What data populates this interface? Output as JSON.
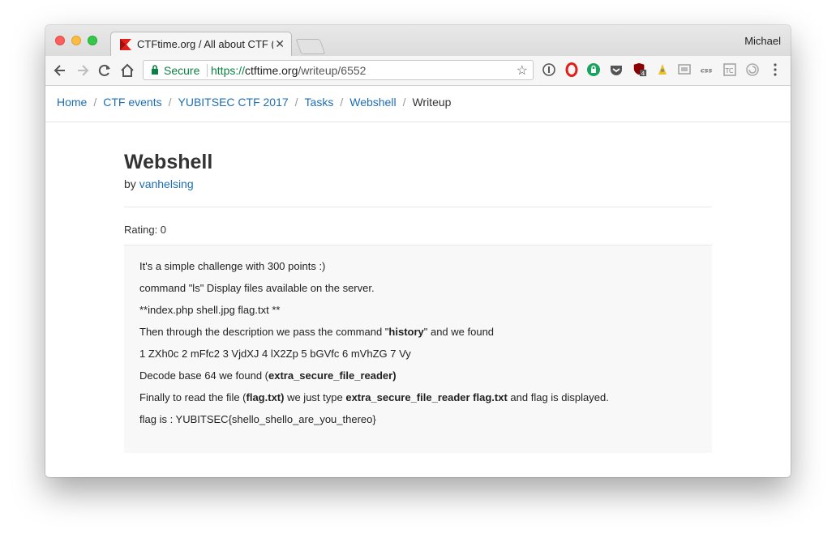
{
  "browser": {
    "tab_title": "CTFtime.org / All about CTF (C",
    "profile_name": "Michael",
    "secure_label": "Secure",
    "url_scheme": "https://",
    "url_host": "ctftime.org",
    "url_path": "/writeup/6552"
  },
  "breadcrumb": {
    "items": [
      "Home",
      "CTF events",
      "YUBITSEC CTF 2017",
      "Tasks",
      "Webshell"
    ],
    "active": "Writeup",
    "divider": "/"
  },
  "writeup": {
    "title": "Webshell",
    "by_label": "by",
    "author": "vanhelsing",
    "rating": "Rating: 0",
    "lines": {
      "l1": "It's a simple challenge with 300 points :)",
      "l2": "command \"ls\" Display files available on the server.",
      "l3": "**index.php shell.jpg flag.txt **",
      "l4_pre": "Then through the description we pass the command \"",
      "l4_bold": "history",
      "l4_post": "\" and we found",
      "l5": "1 ZXh0c 2 mFfc2 3 VjdXJ 4 lX2Zp 5 bGVfc 6 mVhZG 7 Vy",
      "l6_pre": "Decode base 64 we found (",
      "l6_bold": "extra_secure_file_reader)",
      "l7_pre": "Finally to read the file (",
      "l7_bold1": "flag.txt)",
      "l7_mid": " we just type ",
      "l7_bold2": "extra_secure_file_reader flag.txt",
      "l7_post": " and flag is displayed.",
      "l8": "flag is : YUBITSEC{shello_shello_are_you_thereo}"
    }
  },
  "colors": {
    "link": "#1e6eb5",
    "secure_green": "#0b8043"
  }
}
